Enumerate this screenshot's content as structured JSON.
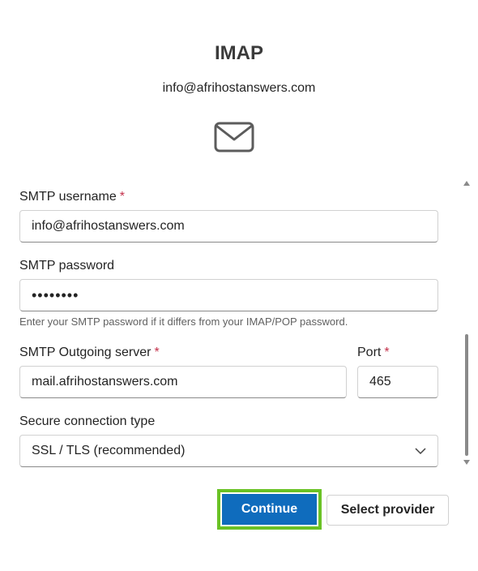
{
  "header": {
    "title": "IMAP",
    "account_email": "info@afrihostanswers.com",
    "icon": "mail-icon"
  },
  "form": {
    "smtp_username": {
      "label": "SMTP username",
      "required_marker": "*",
      "value": "info@afrihostanswers.com"
    },
    "smtp_password": {
      "label": "SMTP password",
      "value": "••••••••",
      "hint": "Enter your SMTP password if it differs from your IMAP/POP password."
    },
    "smtp_server": {
      "label": "SMTP Outgoing server",
      "required_marker": "*",
      "value": "mail.afrihostanswers.com"
    },
    "port": {
      "label": "Port",
      "required_marker": "*",
      "value": "465"
    },
    "secure_connection": {
      "label": "Secure connection type",
      "selected": "SSL / TLS (recommended)"
    }
  },
  "actions": {
    "continue_label": "Continue",
    "select_provider_label": "Select provider"
  },
  "colors": {
    "primary": "#0f6cbd",
    "highlight": "#6ac225",
    "required": "#c4314b"
  }
}
